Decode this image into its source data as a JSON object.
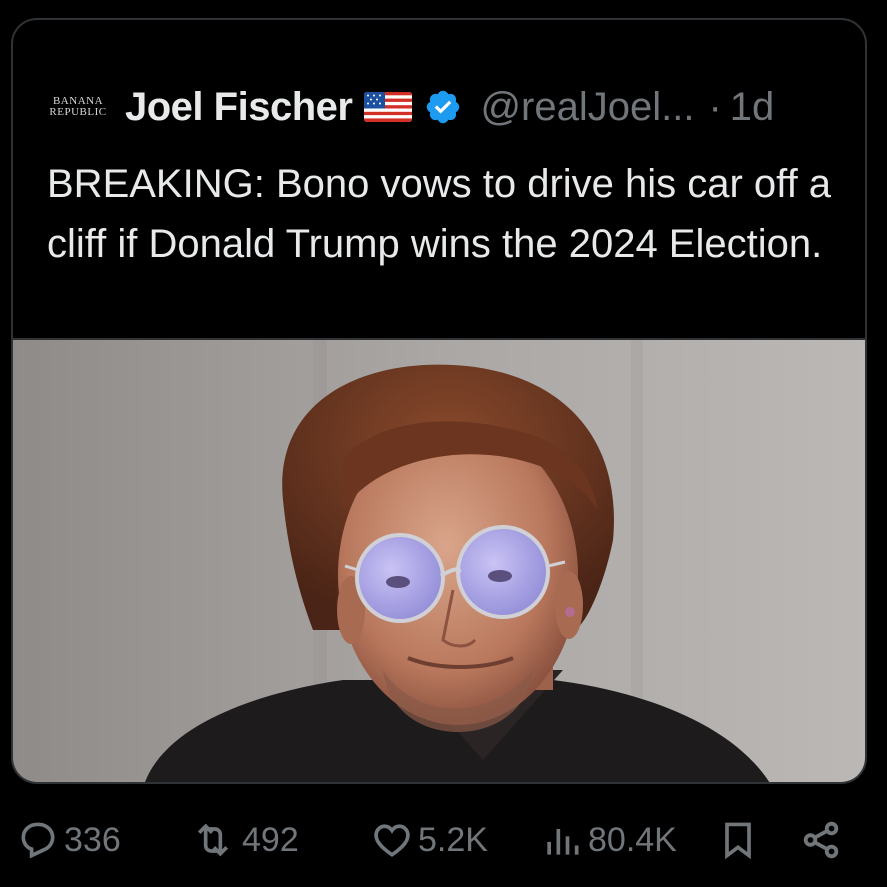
{
  "tweet": {
    "avatar_line1": "BANANA",
    "avatar_line2": "REPUBLIC",
    "display_name": "Joel Fischer",
    "handle": "@realJoel...",
    "separator": "·",
    "time": "1d",
    "text": "BREAKING: Bono vows to drive his car off a cliff if Donald Trump wins the 2024 Election."
  },
  "actions": {
    "replies": "336",
    "reposts": "492",
    "likes": "5.2K",
    "views": "80.4K"
  },
  "icons": {
    "flag": "us-flag-icon",
    "verified": "verified-badge-icon",
    "reply": "reply-icon",
    "repost": "repost-icon",
    "like": "heart-icon",
    "views": "views-chart-icon",
    "bookmark": "bookmark-icon",
    "share": "share-icon"
  },
  "colors": {
    "background": "#000000",
    "text": "#e7e9ea",
    "muted": "#71767b",
    "verified": "#1d9bf0",
    "border": "#2f3336"
  }
}
